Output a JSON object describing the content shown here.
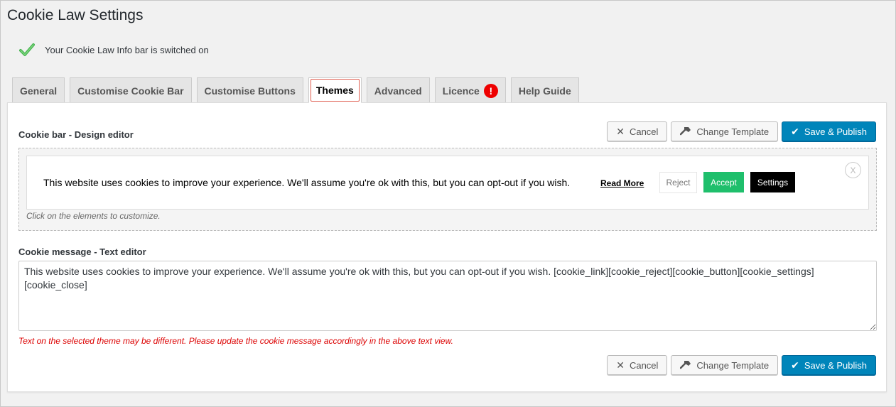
{
  "page": {
    "title": "Cookie Law Settings"
  },
  "notice": {
    "text": "Your Cookie Law Info bar is switched on"
  },
  "tabs": [
    {
      "label": "General"
    },
    {
      "label": "Customise Cookie Bar"
    },
    {
      "label": "Customise Buttons"
    },
    {
      "label": "Themes",
      "active": true
    },
    {
      "label": "Advanced"
    },
    {
      "label": "Licence",
      "alert": "!"
    },
    {
      "label": "Help Guide"
    }
  ],
  "design_editor": {
    "label": "Cookie bar - Design editor",
    "preview": {
      "message": "This website uses cookies to improve your experience. We'll assume you're ok with this, but you can opt-out if you wish.",
      "read_more": "Read More",
      "reject": "Reject",
      "accept": "Accept",
      "settings": "Settings",
      "close": "X"
    },
    "hint": "Click on the elements to customize."
  },
  "text_editor": {
    "label": "Cookie message - Text editor",
    "value": "This website uses cookies to improve your experience. We'll assume you're ok with this, but you can opt-out if you wish. [cookie_link][cookie_reject][cookie_button][cookie_settings][cookie_close]",
    "warning": "Text on the selected theme may be different. Please update the cookie message accordingly in the above text view."
  },
  "actions": {
    "cancel": "Cancel",
    "change_template": "Change Template",
    "save_publish": "Save & Publish"
  },
  "colors": {
    "primary": "#0085ba",
    "accept": "#1fbf6c",
    "warning": "#dc0000",
    "active_tab_outline": "#e05d4f"
  }
}
